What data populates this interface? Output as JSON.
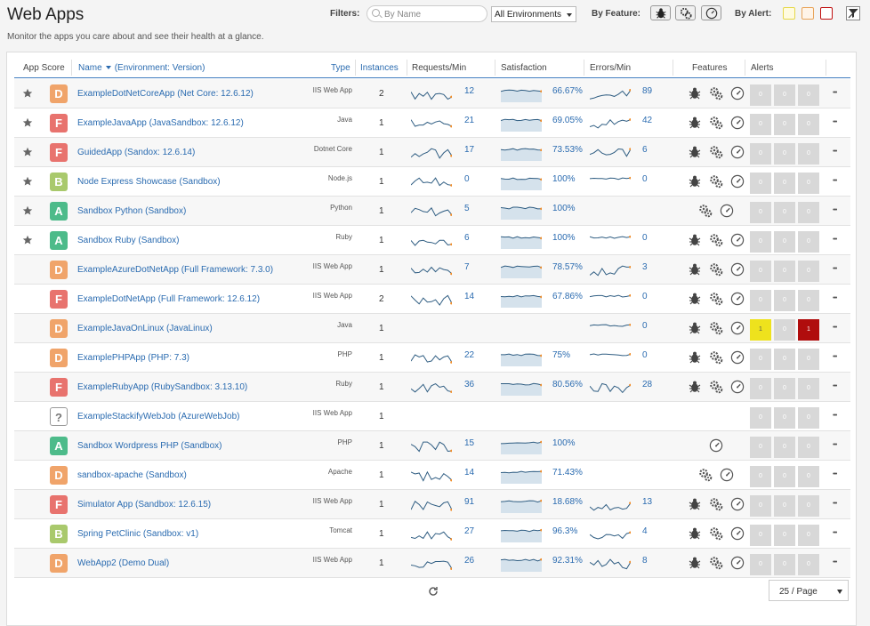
{
  "page": {
    "title": "Web Apps",
    "subtitle": "Monitor the apps you care about and see their health at a glance."
  },
  "filters": {
    "label": "Filters:",
    "search_placeholder": "By Name",
    "environment": "All Environments",
    "by_feature_label": "By Feature:",
    "by_alert_label": "By Alert:",
    "alert_colors": [
      "#f5e07a",
      "#f0b060",
      "#c01010"
    ]
  },
  "table": {
    "headers": {
      "score": "App Score",
      "name": "Name",
      "env": "(Environment: Version)",
      "type": "Type",
      "instances": "Instances",
      "requests": "Requests/Min",
      "satisfaction": "Satisfaction",
      "errors": "Errors/Min",
      "features": "Features",
      "alerts": "Alerts"
    },
    "rows": [
      {
        "star": true,
        "grade": "D",
        "name": "ExampleDotNetCoreApp (Net Core: 12.6.12)",
        "type": "IIS Web App",
        "instances": "2",
        "requests": "12",
        "satisfaction": "66.67%",
        "errors": "89",
        "features": [
          "bug",
          "gears",
          "gauge"
        ],
        "alerts": [
          "0",
          "0",
          "0"
        ],
        "alert_levels": [
          "",
          "",
          ""
        ]
      },
      {
        "star": true,
        "grade": "F",
        "name": "ExampleJavaApp (JavaSandbox: 12.6.12)",
        "type": "Java",
        "instances": "1",
        "requests": "21",
        "satisfaction": "69.05%",
        "errors": "42",
        "features": [
          "bug",
          "gears",
          "gauge"
        ],
        "alerts": [
          "0",
          "0",
          "0"
        ],
        "alert_levels": [
          "",
          "",
          ""
        ]
      },
      {
        "star": true,
        "grade": "F",
        "name": "GuidedApp (Sandox: 12.6.14)",
        "type": "Dotnet Core",
        "instances": "1",
        "requests": "17",
        "satisfaction": "73.53%",
        "errors": "6",
        "features": [
          "bug",
          "gears",
          "gauge"
        ],
        "alerts": [
          "0",
          "0",
          "0"
        ],
        "alert_levels": [
          "",
          "",
          ""
        ]
      },
      {
        "star": true,
        "grade": "B",
        "name": "Node Express Showcase (Sandbox)",
        "type": "Node.js",
        "instances": "1",
        "requests": "0",
        "satisfaction": "100%",
        "errors": "0",
        "features": [
          "bug",
          "gears",
          "gauge"
        ],
        "alerts": [
          "0",
          "0",
          "0"
        ],
        "alert_levels": [
          "",
          "",
          ""
        ]
      },
      {
        "star": true,
        "grade": "A",
        "name": "Sandbox Python (Sandbox)",
        "type": "Python",
        "instances": "1",
        "requests": "5",
        "satisfaction": "100%",
        "errors": "",
        "features": [
          "gears",
          "gauge"
        ],
        "alerts": [
          "0",
          "0",
          "0"
        ],
        "alert_levels": [
          "",
          "",
          ""
        ]
      },
      {
        "star": true,
        "grade": "A",
        "name": "Sandbox Ruby (Sandbox)",
        "type": "Ruby",
        "instances": "1",
        "requests": "6",
        "satisfaction": "100%",
        "errors": "0",
        "features": [
          "bug",
          "gears",
          "gauge"
        ],
        "alerts": [
          "0",
          "0",
          "0"
        ],
        "alert_levels": [
          "",
          "",
          ""
        ]
      },
      {
        "star": false,
        "grade": "D",
        "name": "ExampleAzureDotNetApp (Full Framework: 7.3.0)",
        "type": "IIS Web App",
        "instances": "1",
        "requests": "7",
        "satisfaction": "78.57%",
        "errors": "3",
        "features": [
          "bug",
          "gears",
          "gauge"
        ],
        "alerts": [
          "0",
          "0",
          "0"
        ],
        "alert_levels": [
          "",
          "",
          ""
        ]
      },
      {
        "star": false,
        "grade": "F",
        "name": "ExampleDotNetApp (Full Framework: 12.6.12)",
        "type": "IIS Web App",
        "instances": "2",
        "requests": "14",
        "satisfaction": "67.86%",
        "errors": "0",
        "features": [
          "bug",
          "gears",
          "gauge"
        ],
        "alerts": [
          "0",
          "0",
          "0"
        ],
        "alert_levels": [
          "",
          "",
          ""
        ]
      },
      {
        "star": false,
        "grade": "D",
        "name": "ExampleJavaOnLinux (JavaLinux)",
        "type": "Java",
        "instances": "1",
        "requests": "",
        "satisfaction": "",
        "errors": "0",
        "features": [
          "bug",
          "gears",
          "gauge"
        ],
        "alerts": [
          "1",
          "0",
          "1"
        ],
        "alert_levels": [
          "yel",
          "",
          "red"
        ]
      },
      {
        "star": false,
        "grade": "D",
        "name": "ExamplePHPApp (PHP: 7.3)",
        "type": "PHP",
        "instances": "1",
        "requests": "22",
        "satisfaction": "75%",
        "errors": "0",
        "features": [
          "bug",
          "gears",
          "gauge"
        ],
        "alerts": [
          "0",
          "0",
          "0"
        ],
        "alert_levels": [
          "",
          "",
          ""
        ]
      },
      {
        "star": false,
        "grade": "F",
        "name": "ExampleRubyApp (RubySandbox: 3.13.10)",
        "type": "Ruby",
        "instances": "1",
        "requests": "36",
        "satisfaction": "80.56%",
        "errors": "28",
        "features": [
          "bug",
          "gears",
          "gauge"
        ],
        "alerts": [
          "0",
          "0",
          "0"
        ],
        "alert_levels": [
          "",
          "",
          ""
        ]
      },
      {
        "star": false,
        "grade": "?",
        "name": "ExampleStackifyWebJob (AzureWebJob)",
        "type": "IIS Web App",
        "instances": "1",
        "requests": "",
        "satisfaction": "",
        "errors": "",
        "features": [],
        "alerts": [
          "0",
          "0",
          "0"
        ],
        "alert_levels": [
          "",
          "",
          ""
        ]
      },
      {
        "star": false,
        "grade": "A",
        "name": "Sandbox Wordpress PHP (Sandbox)",
        "type": "PHP",
        "instances": "1",
        "requests": "15",
        "satisfaction": "100%",
        "errors": "",
        "features": [
          "gauge"
        ],
        "alerts": [
          "0",
          "0",
          "0"
        ],
        "alert_levels": [
          "",
          "",
          ""
        ]
      },
      {
        "star": false,
        "grade": "D",
        "name": "sandbox-apache (Sandbox)",
        "type": "Apache",
        "instances": "1",
        "requests": "14",
        "satisfaction": "71.43%",
        "errors": "",
        "features": [
          "gears",
          "gauge"
        ],
        "alerts": [
          "0",
          "0",
          "0"
        ],
        "alert_levels": [
          "",
          "",
          ""
        ]
      },
      {
        "star": false,
        "grade": "F",
        "name": "Simulator App (Sandbox: 12.6.15)",
        "type": "IIS Web App",
        "instances": "1",
        "requests": "91",
        "satisfaction": "18.68%",
        "errors": "13",
        "features": [
          "bug",
          "gears",
          "gauge"
        ],
        "alerts": [
          "0",
          "0",
          "0"
        ],
        "alert_levels": [
          "",
          "",
          ""
        ]
      },
      {
        "star": false,
        "grade": "B",
        "name": "Spring PetClinic (Sandbox: v1)",
        "type": "Tomcat",
        "instances": "1",
        "requests": "27",
        "satisfaction": "96.3%",
        "errors": "4",
        "features": [
          "bug",
          "gears",
          "gauge"
        ],
        "alerts": [
          "0",
          "0",
          "0"
        ],
        "alert_levels": [
          "",
          "",
          ""
        ]
      },
      {
        "star": false,
        "grade": "D",
        "name": "WebApp2 (Demo Dual)",
        "type": "IIS Web App",
        "instances": "1",
        "requests": "26",
        "satisfaction": "92.31%",
        "errors": "8",
        "features": [
          "bug",
          "gears",
          "gauge"
        ],
        "alerts": [
          "0",
          "0",
          "0"
        ],
        "alert_levels": [
          "",
          "",
          ""
        ]
      }
    ]
  },
  "footer": {
    "page_size": "25 / Page"
  }
}
